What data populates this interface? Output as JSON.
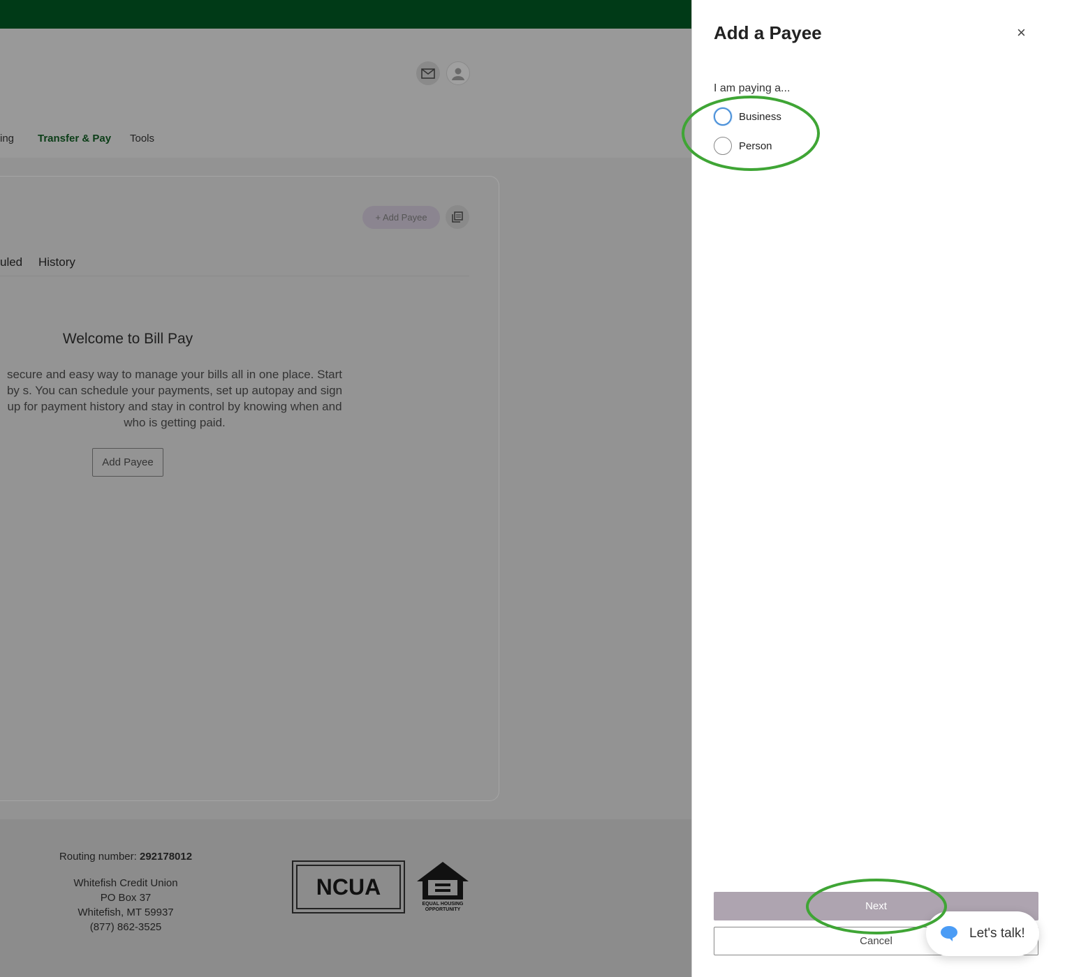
{
  "nav": {
    "items": [
      "ing",
      "Transfer & Pay",
      "Tools"
    ],
    "active": "Transfer & Pay"
  },
  "header": {
    "icons": [
      "mail-icon",
      "user-icon"
    ]
  },
  "card": {
    "add_payee_pill": "+ Add Payee",
    "tabs": [
      "uled",
      "History"
    ],
    "welcome_title": "Welcome to Bill Pay",
    "description": "secure and easy way to manage your bills all in one place. Start by s. You can schedule your payments, set up autopay and sign up for payment history and stay in control by knowing when and who is getting paid.",
    "add_payee_button": "Add Payee"
  },
  "footer": {
    "routing_label": "Routing number:",
    "routing_number": "292178012",
    "name": "Whitefish Credit Union",
    "address1": "PO Box 37",
    "address2": "Whitefish, MT 59937",
    "phone": "(877) 862-3525",
    "ncua_logo": "NCUA",
    "ehl_logo": "EQUAL HOUSING OPPORTUNITY"
  },
  "panel": {
    "title": "Add a Payee",
    "close": "×",
    "prompt": "I am paying a...",
    "options": [
      "Business",
      "Person"
    ],
    "next": "Next",
    "cancel": "Cancel"
  },
  "chat": {
    "label": "Let's talk!"
  },
  "colors": {
    "brand_green": "#003a17",
    "annotation": "#3fa535",
    "next_bg": "#aea4b0"
  }
}
